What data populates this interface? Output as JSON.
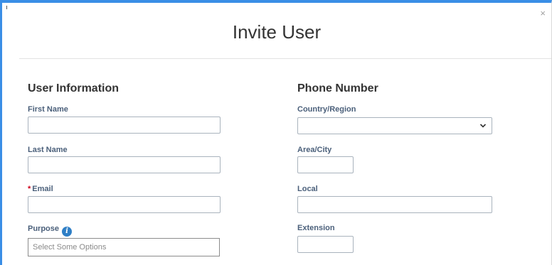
{
  "dialog": {
    "title": "Invite User",
    "close_glyph": "×"
  },
  "user_information": {
    "heading": "User Information",
    "first_name_label": "First Name",
    "first_name_value": "",
    "last_name_label": "Last Name",
    "last_name_value": "",
    "email_required_marker": "*",
    "email_label": "Email",
    "email_value": "",
    "purpose_label": "Purpose",
    "purpose_info_glyph": "i",
    "purpose_placeholder": "Select Some Options"
  },
  "phone_number": {
    "heading": "Phone Number",
    "country_label": "Country/Region",
    "country_value": "",
    "area_label": "Area/City",
    "area_value": "",
    "local_label": "Local",
    "local_value": "",
    "extension_label": "Extension",
    "extension_value": ""
  },
  "colors": {
    "accent": "#3a8ee6",
    "required": "#d0021b",
    "info": "#2f7fc6"
  }
}
